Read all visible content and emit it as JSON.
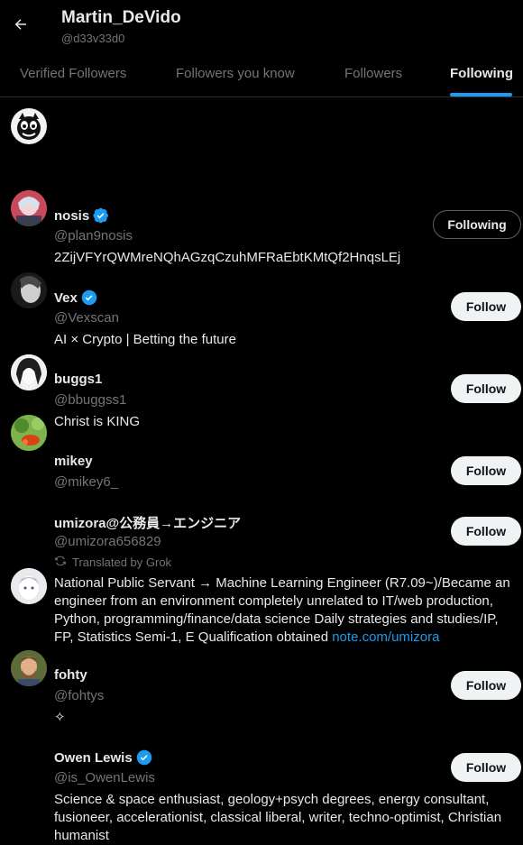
{
  "header": {
    "title": "Martin_DeVido",
    "handle": "@d33v33d0"
  },
  "tabs": [
    {
      "label": "Verified Followers"
    },
    {
      "label": "Followers you know"
    },
    {
      "label": "Followers"
    },
    {
      "label": "Following"
    }
  ],
  "active_tab": "Following",
  "accounts": [
    {
      "name": "nosis",
      "verified": true,
      "handle": "@plan9nosis",
      "bio": "2ZijVFYrQWMreNQhAGzqCzuhMFRaEbtKMtQf2HnqsLEj",
      "button": "Following"
    },
    {
      "name": "Vex",
      "verified": true,
      "handle": "@Vexscan",
      "bio": "AI × Crypto | Betting the future",
      "button": "Follow"
    },
    {
      "name": "buggs1",
      "verified": false,
      "handle": "@bbuggss1",
      "bio": "Christ is KING",
      "button": "Follow"
    },
    {
      "name": "mikey",
      "verified": false,
      "handle": "@mikey6_",
      "bio": "",
      "button": "Follow"
    },
    {
      "name": "umizora@公務員→エンジニア",
      "verified": false,
      "handle": "@umizora656829",
      "translated_label": "Translated by Grok",
      "bio": "National Public Servant → Machine Learning Engineer (R7.09~)/Became an engineer from an environment completely unrelated to IT/web production, Python, programming/finance/data science Daily strategies and studies/IP, FP, Statistics Semi-1, E Qualification obtained",
      "bio_link": "note.com/umizora",
      "button": "Follow"
    },
    {
      "name": "fohty",
      "verified": false,
      "handle": "@fohtys",
      "bio": "✧",
      "button": "Follow"
    },
    {
      "name": "Owen Lewis",
      "verified": true,
      "handle": "@is_OwenLewis",
      "bio": "Science & space enthusiast, geology+psych degrees, energy consultant, fusioneer, accelerationist, classical liberal, writer, techno-optimist, Christian humanist",
      "button": "Follow"
    }
  ],
  "colors": {
    "accent": "#1d9bf0",
    "muted": "#71767b",
    "text": "#e7e9ea",
    "background": "#000000"
  }
}
